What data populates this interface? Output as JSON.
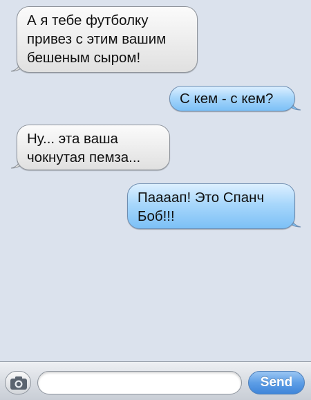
{
  "conversation": {
    "messages": [
      {
        "direction": "incoming",
        "lines": [
          "А я тебе футболку",
          "привез с этим вашим",
          "бешеным сыром!"
        ]
      },
      {
        "direction": "outgoing",
        "lines": [
          "С кем - с кем?"
        ]
      },
      {
        "direction": "incoming",
        "lines": [
          "Ну... эта ваша",
          "чокнутая пемза..."
        ]
      },
      {
        "direction": "outgoing",
        "lines": [
          "Паааап! Это Спанч",
          "Боб!!!"
        ]
      }
    ]
  },
  "composer": {
    "input_value": "",
    "input_placeholder": "",
    "send_label": "Send",
    "camera_icon": "camera-icon"
  },
  "colors": {
    "background": "#dbe2ed",
    "incoming_bubble": "#ececec",
    "outgoing_bubble": "#a8d7fb",
    "send_button": "#5d9ee6"
  }
}
